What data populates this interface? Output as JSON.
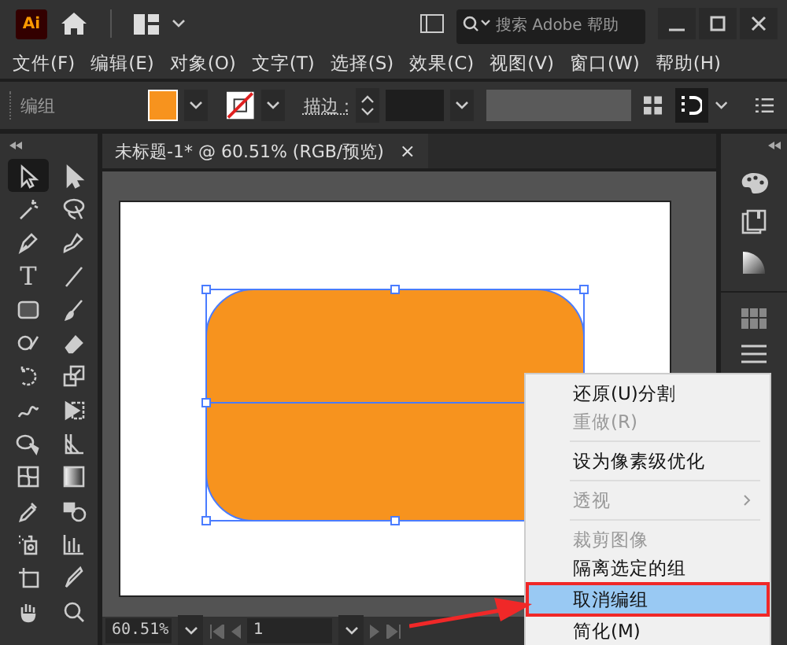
{
  "title_bar": {
    "logo": "Ai",
    "search_placeholder": "搜索 Adobe 帮助"
  },
  "menu_bar": [
    "文件(F)",
    "编辑(E)",
    "对象(O)",
    "文字(T)",
    "选择(S)",
    "效果(C)",
    "视图(V)",
    "窗口(W)",
    "帮助(H)"
  ],
  "control_bar": {
    "selection_label": "编组",
    "stroke_label": "描边 :"
  },
  "tools": [
    {
      "selected": true
    },
    {
      "selected": false
    },
    {
      "selected": false
    },
    {
      "selected": false
    },
    {
      "selected": false
    },
    {
      "selected": false
    },
    {
      "selected": false,
      "label": "T"
    },
    {
      "selected": false
    },
    {
      "selected": false
    },
    {
      "selected": false
    },
    {
      "selected": false
    },
    {
      "selected": false
    },
    {
      "selected": false
    },
    {
      "selected": false
    },
    {
      "selected": false
    },
    {
      "selected": false
    },
    {
      "selected": false
    },
    {
      "selected": false
    },
    {
      "selected": false
    },
    {
      "selected": false
    },
    {
      "selected": false
    },
    {
      "selected": false
    },
    {
      "selected": false
    },
    {
      "selected": false
    },
    {
      "selected": false
    },
    {
      "selected": false
    },
    {
      "selected": false
    },
    {
      "selected": false
    }
  ],
  "document_tab": {
    "title": "未标题-1* @ 60.51% (RGB/预览)",
    "close": "×"
  },
  "status_bar": {
    "zoom": "60.51%",
    "page": "1"
  },
  "context_menu": {
    "items": [
      {
        "kind": "item",
        "label": "还原(U)分割",
        "disabled": false,
        "submenu": false,
        "selected": false
      },
      {
        "kind": "item",
        "label": "重做(R)",
        "disabled": true,
        "submenu": false,
        "selected": false
      },
      {
        "kind": "separator"
      },
      {
        "kind": "item",
        "label": "设为像素级优化",
        "disabled": false,
        "submenu": false,
        "selected": false
      },
      {
        "kind": "separator"
      },
      {
        "kind": "item",
        "label": "透视",
        "disabled": true,
        "submenu": true,
        "selected": false
      },
      {
        "kind": "separator"
      },
      {
        "kind": "item",
        "label": "裁剪图像",
        "disabled": true,
        "submenu": false,
        "selected": false
      },
      {
        "kind": "item",
        "label": "隔离选定的组",
        "disabled": false,
        "submenu": false,
        "selected": false
      },
      {
        "kind": "item",
        "label": "取消编组",
        "disabled": false,
        "submenu": false,
        "selected": true
      },
      {
        "kind": "item",
        "label": "简化(M)",
        "disabled": false,
        "submenu": false,
        "selected": false
      }
    ]
  }
}
